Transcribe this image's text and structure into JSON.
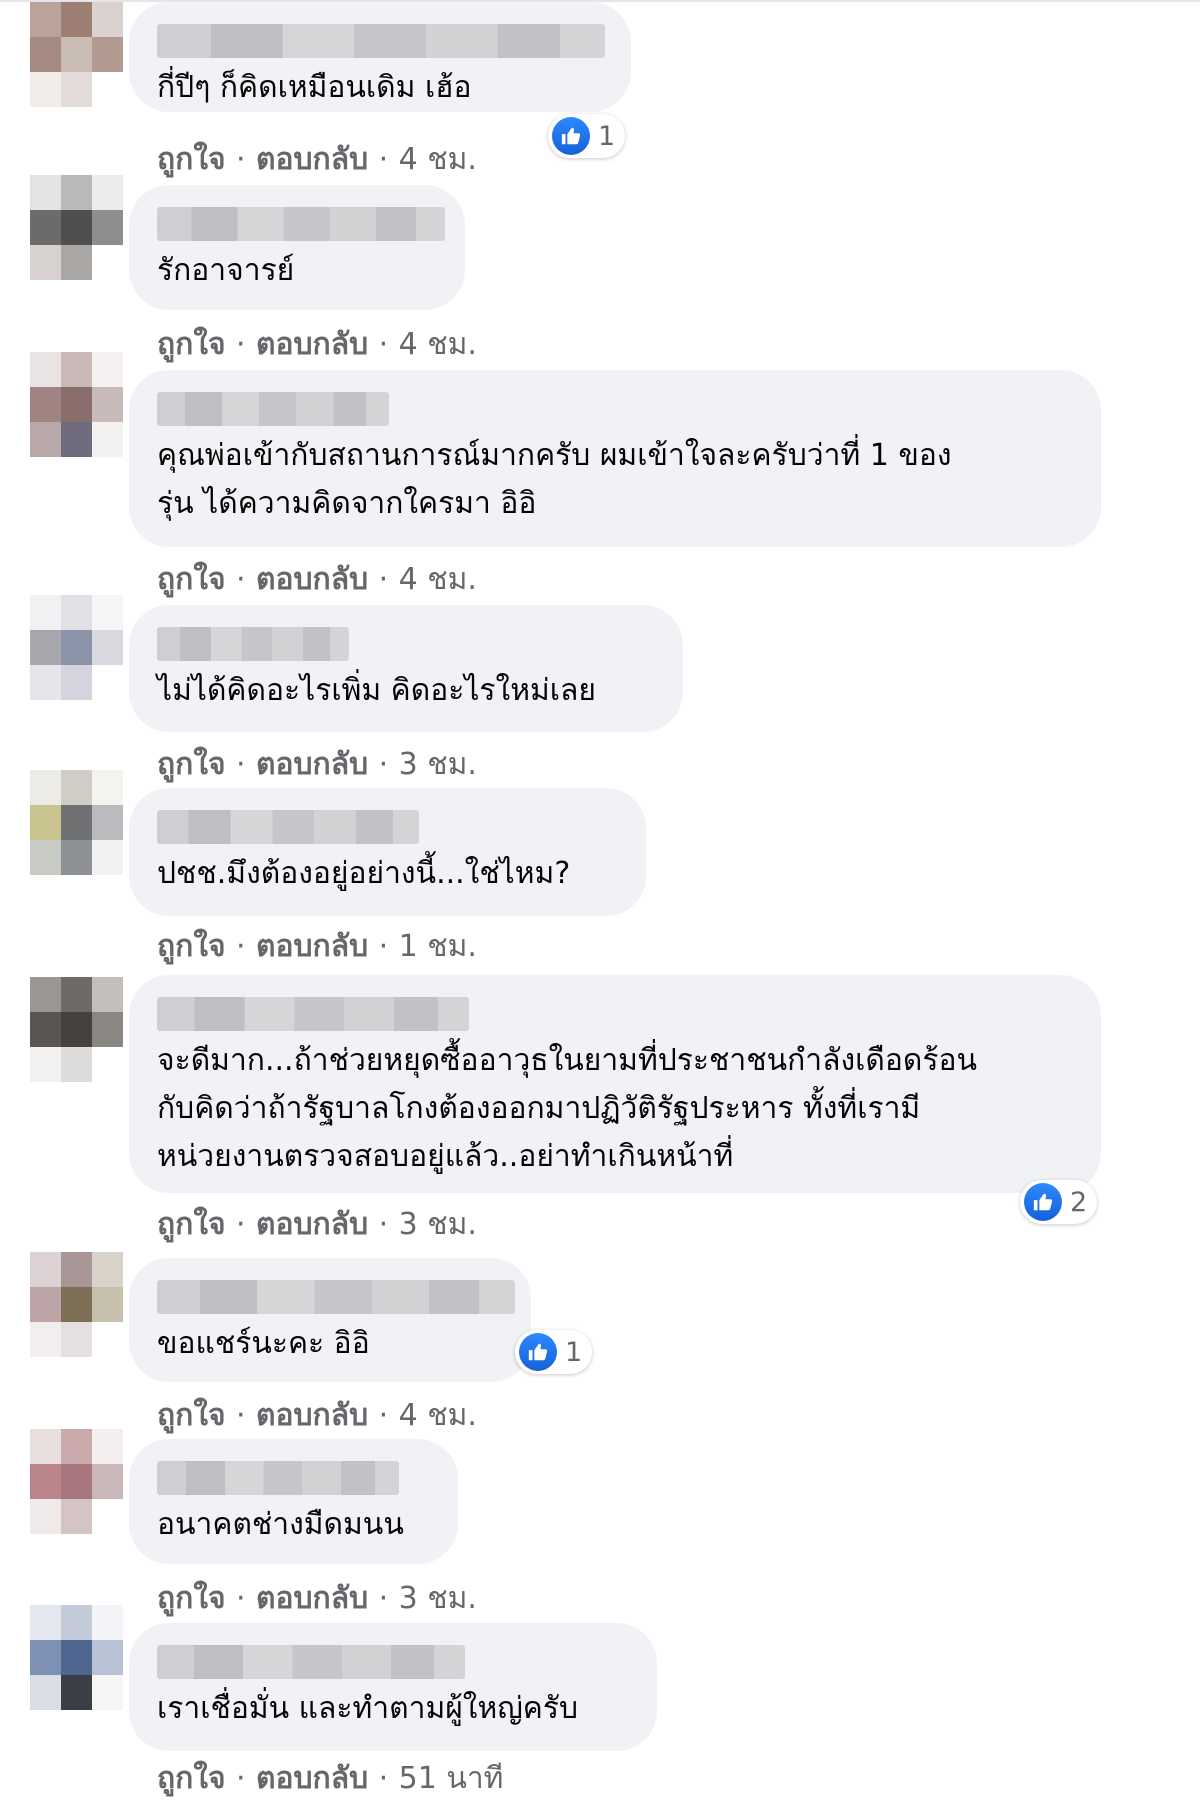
{
  "colors": {
    "bubble": "#f0f2f5",
    "text": "#050505",
    "meta": "#65676b",
    "like_blue": "#1877f2"
  },
  "action_labels": {
    "like": "ถูกใจ",
    "reply": "ตอบกลับ",
    "separator": "·"
  },
  "comments": [
    {
      "text": "กี่ปีๆ ก็คิดเหมือนเดิม เฮ้อ",
      "time": "4 ชม.",
      "reactions": "1",
      "reaction_icon": "like-icon"
    },
    {
      "text": "รักอาจารย์",
      "time": "4 ชม."
    },
    {
      "text": "คุณพ่อเข้ากับสถานการณ์มากครับ ผมเข้าใจละครับว่าที่ 1 ของ\nรุ่น ได้ความคิดจากใครมา อิอิ",
      "time": "4 ชม."
    },
    {
      "text": "ไม่ได้คิดอะไรเพิ่ม คิดอะไรใหม่เลย",
      "time": "3 ชม."
    },
    {
      "text": "ปชช.มึงต้องอยู่อย่างนี้...ใช่ไหม?",
      "time": "1 ชม."
    },
    {
      "text": "จะดีมาก...ถ้าช่วยหยุดซื้ออาวุธในยามที่ประชาชนกำลังเดือดร้อน\nกับคิดว่าถ้ารัฐบาลโกงต้องออกมาปฏิวัติรัฐประหาร ทั้งที่เรามี\nหน่วยงานตรวจสอบอยู่แล้ว..อย่าทำเกินหน้าที่",
      "time": "3 ชม.",
      "reactions": "2",
      "reaction_icon": "like-icon"
    },
    {
      "text": "ขอแชร์นะคะ อิอิ",
      "time": "4 ชม.",
      "reactions": "1",
      "reaction_icon": "like-icon"
    },
    {
      "text": "อนาคตช่างมืดมนน",
      "time": "3 ชม."
    },
    {
      "text": "เราเชื่อมั่น และทำตามผู้ใหญ่ครับ",
      "time": "51 นาที"
    }
  ]
}
